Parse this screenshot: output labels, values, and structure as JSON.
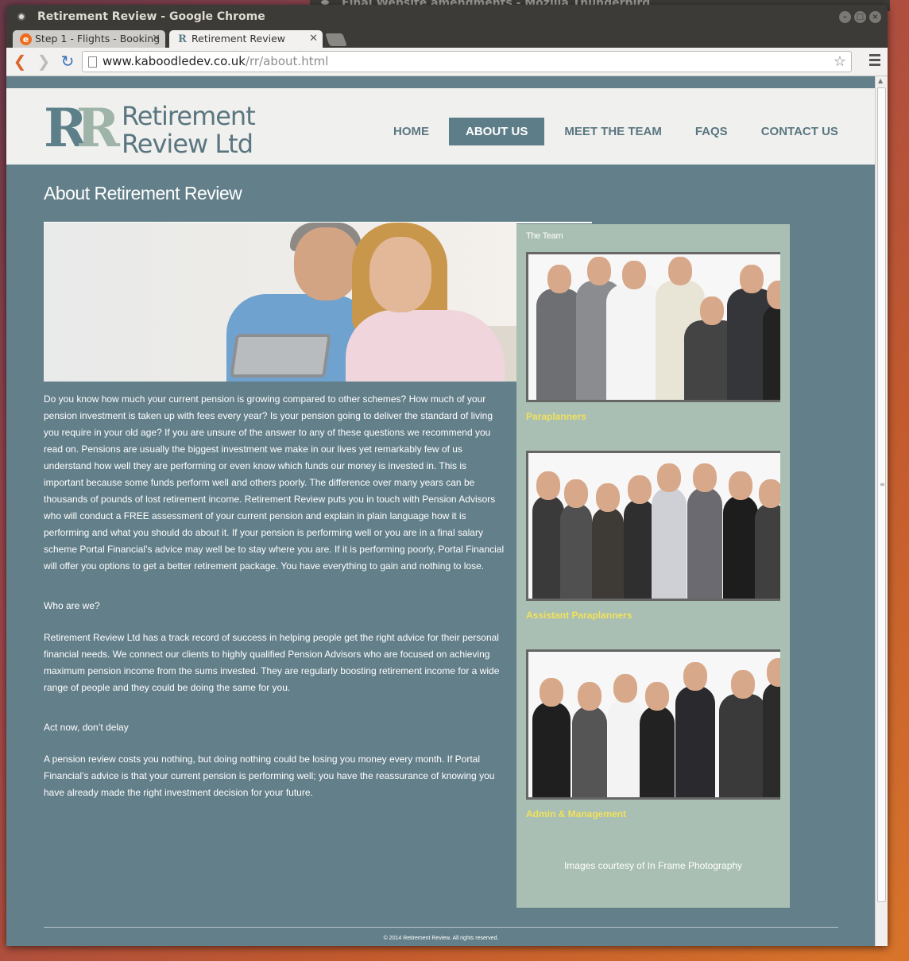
{
  "background_window": {
    "title": "Final Website amendments - Mozilla Thunderbird"
  },
  "window": {
    "title": "Retirement Review - Google Chrome"
  },
  "tabs": [
    {
      "label": "Step 1 - Flights - Booking",
      "favicon": "e"
    },
    {
      "label": "Retirement Review",
      "favicon": "R"
    }
  ],
  "address_bar": {
    "domain": "www.kaboodledev.co.uk",
    "path": "/rr/about.html"
  },
  "site": {
    "logo": {
      "line1": "Retirement",
      "line2": "Review Ltd"
    },
    "nav": [
      "HOME",
      "ABOUT US",
      "MEET THE TEAM",
      "FAQS",
      "CONTACT US"
    ],
    "active_nav": "ABOUT US",
    "page_title": "About Retirement Review",
    "paragraphs": [
      "Do you know how much your current pension is growing compared to other schemes? How much of your pension investment is taken up with fees every year? Is your pension going to deliver the standard of living you require in your old age? If you are unsure of the answer to any of these questions we recommend you read on. Pensions are usually the biggest investment we make in our lives yet remarkably few of us understand how well they are performing or even know which funds our money is invested in. This is important because some funds perform well and others poorly. The difference over many years can be thousands of pounds of lost retirement income. Retirement Review puts you in touch with Pension Advisors who will conduct a FREE assessment of your current pension and explain in plain language how it is performing and what you should do about it. If your pension is performing well or you are in a final salary scheme Portal Financial’s advice may well be to stay where you are. If it is performing poorly, Portal Financial will offer you options to get a better retirement package. You have everything to gain and nothing to lose.",
      "Who are we?",
      "Retirement Review Ltd has a track record of success in helping people get the right advice for their personal financial needs. We connect our clients to highly qualified Pension Advisors who are focused on achieving maximum pension income from the sums invested. They are regularly boosting retirement income for a wide range of people and they could be doing the same for you.",
      "Act now, don’t delay",
      "A pension review costs you nothing, but doing nothing could be losing you money every month. If Portal Financial’s advice is that your current pension is performing well; you have the reassurance of knowing you have already made the right investment decision for your future."
    ],
    "sidebar": {
      "title": "The Team",
      "groups": [
        "Paraplanners",
        "Assistant Paraplanners",
        "Admin & Management"
      ],
      "credit": "Images courtesy of In Frame Photography"
    },
    "footer": "© 2014 Retirement Review. All rights reserved."
  },
  "colors": {
    "page_bg": "#637f89",
    "header_bg": "#f0f0ee",
    "sidebar_bg": "#a9bfb3",
    "caption": "#f2e15b",
    "nav_active": "#5d7e89"
  }
}
